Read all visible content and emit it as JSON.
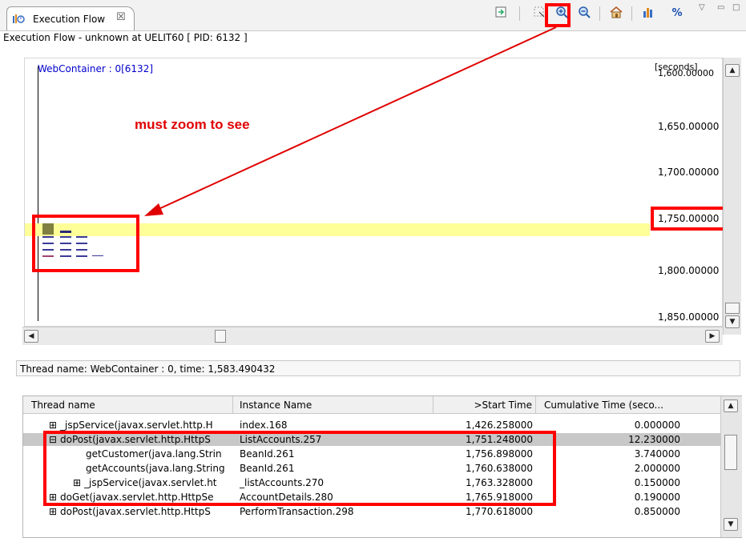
{
  "tab": {
    "title": "Execution Flow",
    "close": "☒"
  },
  "toolbar": {
    "icons": [
      "export-icon",
      "select-icon",
      "zoom-in-icon",
      "zoom-out-icon",
      "home-icon",
      "chart-icon",
      "percent-icon",
      "view-menu-icon",
      "minimize-icon",
      "maximize-icon"
    ],
    "percent_label": "%"
  },
  "subtitle": "Execution Flow - unknown at UELIT60 [ PID: 6132 ]",
  "graph": {
    "thread_label": "WebContainer : 0[6132]",
    "unit": "[seconds]",
    "ticks": [
      "1,600.00000",
      "1,650.00000",
      "1,700.00000",
      "1,750.00000",
      "1,800.00000",
      "1,850.00000"
    ],
    "annotation": "must zoom to see",
    "highlight_color": "#ffff99"
  },
  "status": "Thread name: WebContainer : 0, time: 1,583.490432",
  "table": {
    "columns": [
      "Thread name",
      "Instance Name",
      ">Start Time",
      "Cumulative Time (seco..."
    ],
    "rows": [
      {
        "expander": "⊞",
        "name": "_jspService(javax.servlet.http.H",
        "instance": "index.168",
        "start": "1,426.258000",
        "cumulative": "0.000000"
      },
      {
        "expander": "⊟",
        "name": "doPost(javax.servlet.http.HttpS",
        "instance": "ListAccounts.257",
        "start": "1,751.248000",
        "cumulative": "12.230000"
      },
      {
        "expander": "",
        "name": "getCustomer(java.lang.Strin",
        "instance": "BeanId.261",
        "start": "1,756.898000",
        "cumulative": "3.740000"
      },
      {
        "expander": "",
        "name": "getAccounts(java.lang.String",
        "instance": "BeanId.261",
        "start": "1,760.638000",
        "cumulative": "2.000000"
      },
      {
        "expander": "⊞",
        "name": "_jspService(javax.servlet.ht",
        "instance": "_listAccounts.270",
        "start": "1,763.328000",
        "cumulative": "0.150000"
      },
      {
        "expander": "⊞",
        "name": "doGet(javax.servlet.http.HttpSe",
        "instance": "AccountDetails.280",
        "start": "1,765.918000",
        "cumulative": "0.190000"
      },
      {
        "expander": "⊞",
        "name": "doPost(javax.servlet.http.HttpS",
        "instance": "PerformTransaction.298",
        "start": "1,770.618000",
        "cumulative": "0.850000"
      }
    ]
  },
  "colors": {
    "accent_red": "#ff0000",
    "selected_row": "#c8c8c8",
    "graph_text_blue": "#0000cc"
  }
}
